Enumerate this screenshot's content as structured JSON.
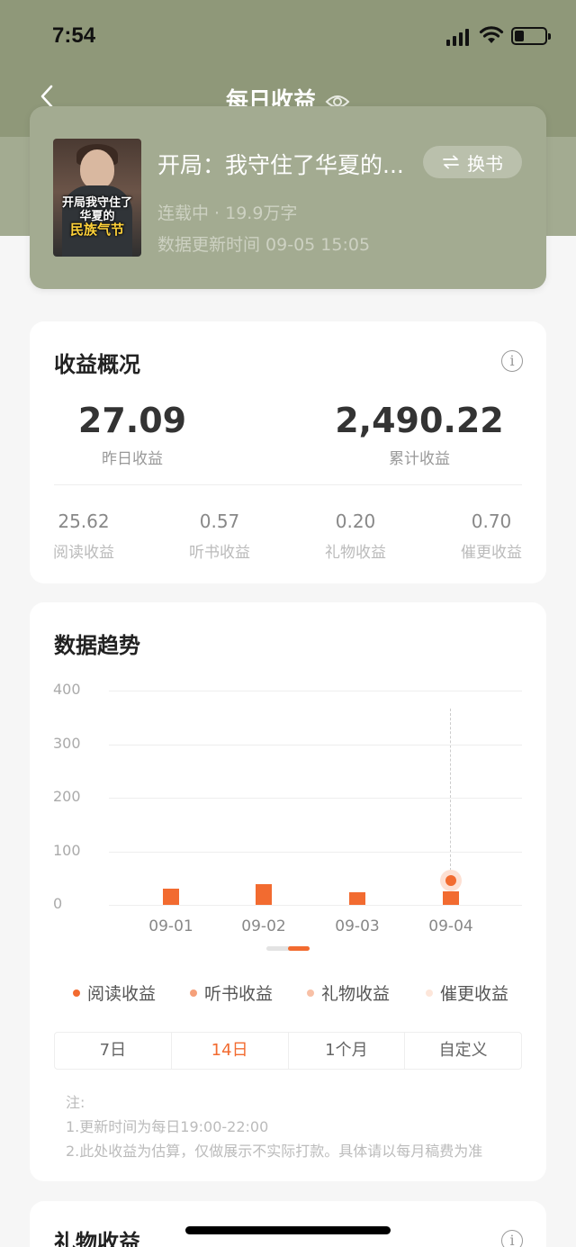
{
  "status_bar": {
    "time": "7:54"
  },
  "nav": {
    "title": "每日收益"
  },
  "book": {
    "title": "开局：我守住了华夏的...",
    "swap_label": "换书",
    "cover_lines": [
      "开局我守住了",
      "华夏的",
      "民族气节"
    ],
    "meta": "连载中 · 19.9万字",
    "update": "数据更新时间 09-05 15:05"
  },
  "overview": {
    "title": "收益概况",
    "yesterday_value": "27.09",
    "yesterday_label": "昨日收益",
    "total_value": "2,490.22",
    "total_label": "累计收益",
    "breakdown": [
      {
        "value": "25.62",
        "label": "阅读收益"
      },
      {
        "value": "0.57",
        "label": "听书收益"
      },
      {
        "value": "0.20",
        "label": "礼物收益"
      },
      {
        "value": "0.70",
        "label": "催更收益"
      }
    ]
  },
  "trend": {
    "title": "数据趋势",
    "legend": [
      {
        "label": "阅读收益",
        "color": "#f26b30"
      },
      {
        "label": "听书收益",
        "color": "#f5a07a"
      },
      {
        "label": "礼物收益",
        "color": "#f8c0a6"
      },
      {
        "label": "催更收益",
        "color": "#fde6da"
      }
    ],
    "ranges": [
      "7日",
      "14日",
      "1个月",
      "自定义"
    ],
    "active_range": "14日"
  },
  "chart_data": {
    "type": "bar",
    "categories": [
      "09-01",
      "09-02",
      "09-03",
      "09-04"
    ],
    "series": [
      {
        "name": "阅读收益",
        "values": [
          30,
          38,
          24,
          25
        ]
      }
    ],
    "highlight_point": {
      "x": "09-04",
      "y": 45
    },
    "yticks": [
      "400",
      "300",
      "200",
      "100",
      "0"
    ],
    "ylim": [
      0,
      400
    ],
    "grid": true
  },
  "notes": {
    "heading": "注:",
    "line1": "1.更新时间为每日19:00-22:00",
    "line2": "2.此处收益为估算，仅做展示不实际打款。具体请以每月稿费为准"
  },
  "gift": {
    "title": "礼物收益"
  }
}
